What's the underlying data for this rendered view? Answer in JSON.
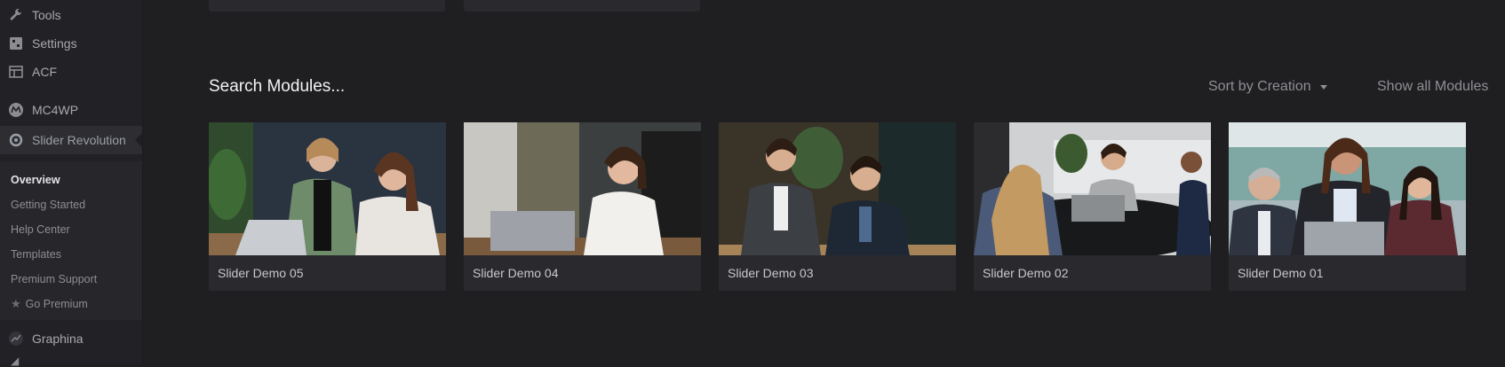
{
  "sidebar": {
    "items": [
      {
        "label": "Tools",
        "icon": "wrench-icon"
      },
      {
        "label": "Settings",
        "icon": "settings-icon"
      },
      {
        "label": "ACF",
        "icon": "table-icon"
      },
      {
        "label": "MC4WP",
        "icon": "mc4wp-icon"
      },
      {
        "label": "Slider Revolution",
        "icon": "slider-revolution-icon"
      },
      {
        "label": "Graphina",
        "icon": "graphina-icon"
      }
    ],
    "submenu": [
      {
        "label": "Overview"
      },
      {
        "label": "Getting Started"
      },
      {
        "label": "Help Center"
      },
      {
        "label": "Templates"
      },
      {
        "label": "Premium Support"
      },
      {
        "label": "Go Premium",
        "icon": "star-icon"
      }
    ]
  },
  "main": {
    "search_label": "Search Modules...",
    "sort_label": "Sort by Creation",
    "show_all_label": "Show all Modules",
    "modules": [
      {
        "title": "Slider Demo 05"
      },
      {
        "title": "Slider Demo 04"
      },
      {
        "title": "Slider Demo 03"
      },
      {
        "title": "Slider Demo 02"
      },
      {
        "title": "Slider Demo 01"
      }
    ]
  }
}
